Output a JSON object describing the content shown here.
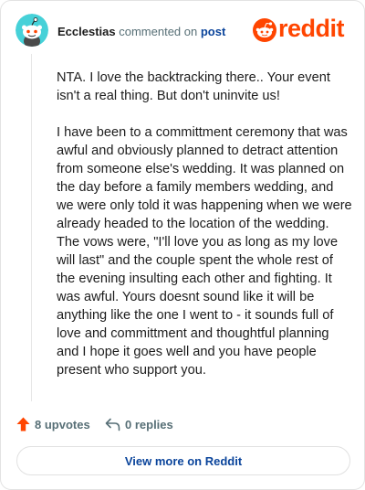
{
  "comment": {
    "username": "Ecclestias",
    "action_text": "commented on",
    "post_link": "post",
    "paragraphs": [
      "NTA. I love the backtracking there.. Your event isn't a real thing. But don't uninvite us!",
      "I have been to a committment ceremony that was awful and obviously planned to detract attention from someone else's wedding. It was planned on the day before a family members wedding, and we were only told it was happening when we were already headed to the location of the wedding. The vows were, \"I'll love you as long as my love will last\" and the couple spent the whole rest of the evening insulting each other and fighting. It was awful. Yours doesnt sound like it will be anything like the one I went to - it sounds full of love and committment and thoughtful planning and I hope it goes well and you have people present who support you."
    ]
  },
  "brand": {
    "logo_text": "reddit",
    "accent_color": "#ff4500",
    "link_color": "#0a449b"
  },
  "actions": {
    "upvotes": "8 upvotes",
    "replies": "0 replies",
    "upvote_icon": "upvote-arrow-icon",
    "reply_icon": "reply-arrow-icon"
  },
  "footer": {
    "view_more_label": "View more on Reddit"
  }
}
